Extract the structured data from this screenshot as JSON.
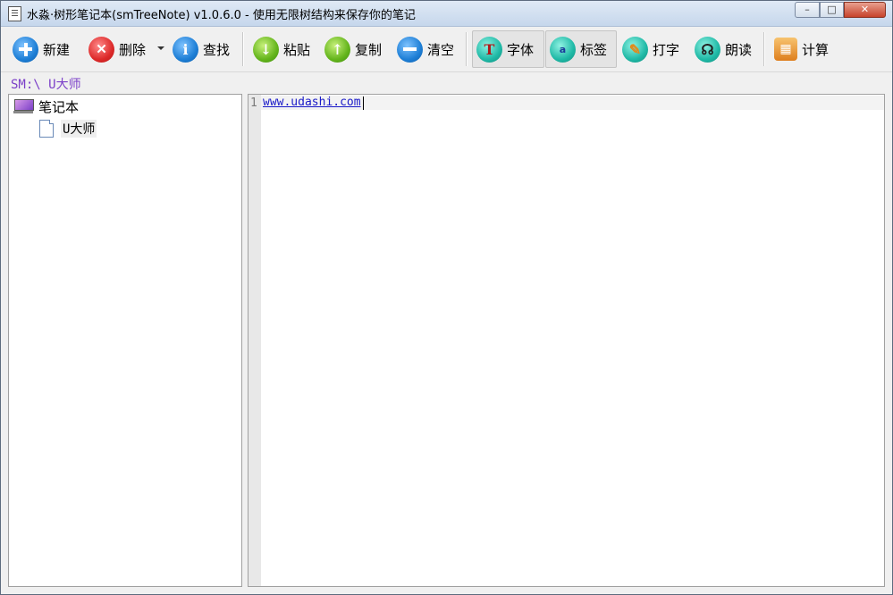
{
  "window": {
    "title": "水淼·树形笔记本(smTreeNote) v1.0.6.0 - 使用无限树结构来保存你的笔记",
    "controls": {
      "minimize": "–",
      "maximize": "□",
      "close": "✕"
    }
  },
  "toolbar": {
    "buttons": [
      {
        "label": "新建",
        "icon": "plus-icon"
      },
      {
        "label": "删除",
        "icon": "delete-icon"
      },
      {
        "label": "查找",
        "icon": "info-icon"
      },
      {
        "label": "粘贴",
        "icon": "arrow-down-icon"
      },
      {
        "label": "复制",
        "icon": "arrow-up-icon"
      },
      {
        "label": "清空",
        "icon": "minus-icon"
      },
      {
        "label": "字体",
        "icon": "font-icon"
      },
      {
        "label": "标签",
        "icon": "tag-icon"
      },
      {
        "label": "打字",
        "icon": "pencil-icon"
      },
      {
        "label": "朗读",
        "icon": "headphones-icon"
      },
      {
        "label": "计算",
        "icon": "calculator-icon"
      }
    ],
    "glyphs": {
      "info": "i",
      "down": "↓",
      "up": "↑",
      "font": "T",
      "tag": "a",
      "pencil": "✎",
      "headphones": "☊",
      "calculator": "▦"
    }
  },
  "path": {
    "text": "SM:\\ U大师"
  },
  "tree": {
    "root_label": "笔记本",
    "children": [
      {
        "label": "U大师"
      }
    ]
  },
  "editor": {
    "line_number": "1",
    "line_text": "www.udashi.com"
  }
}
